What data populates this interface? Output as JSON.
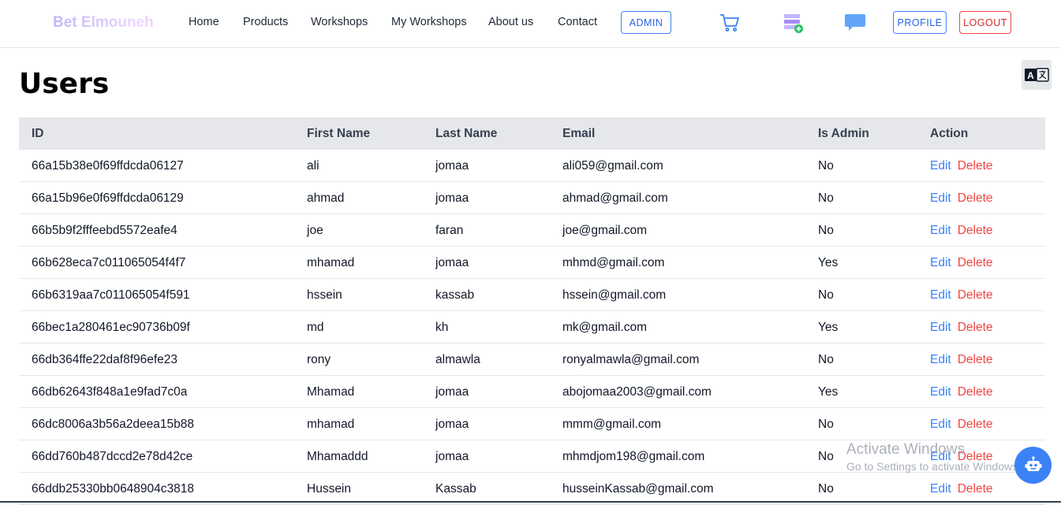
{
  "nav": {
    "brand": "Bet Elmouneh",
    "links": [
      "Home",
      "Products",
      "Workshops",
      "My Workshops",
      "About us",
      "Contact"
    ],
    "admin_label": "ADMIN",
    "profile_label": "PROFILE",
    "logout_label": "LOGOUT",
    "icons": [
      "cart-icon",
      "add-list-icon",
      "chat-icon"
    ]
  },
  "translate_icon": "translate-icon",
  "page": {
    "title": "Users"
  },
  "table": {
    "headers": [
      "ID",
      "First Name",
      "Last Name",
      "Email",
      "Is Admin",
      "Action"
    ],
    "edit_label": "Edit",
    "delete_label": "Delete",
    "rows": [
      {
        "id": "66a15b38e0f69ffdcda06127",
        "first": "ali",
        "last": "jomaa",
        "email": "ali059@gmail.com",
        "admin": "No"
      },
      {
        "id": "66a15b96e0f69ffdcda06129",
        "first": "ahmad",
        "last": "jomaa",
        "email": "ahmad@gmail.com",
        "admin": "No"
      },
      {
        "id": "66b5b9f2fffeebd5572eafe4",
        "first": "joe",
        "last": "faran",
        "email": "joe@gmail.com",
        "admin": "No"
      },
      {
        "id": "66b628eca7c011065054f4f7",
        "first": "mhamad",
        "last": "jomaa",
        "email": "mhmd@gmail.com",
        "admin": "Yes"
      },
      {
        "id": "66b6319aa7c011065054f591",
        "first": "hssein",
        "last": "kassab",
        "email": "hssein@gmail.com",
        "admin": "No"
      },
      {
        "id": "66bec1a280461ec90736b09f",
        "first": "md",
        "last": "kh",
        "email": "mk@gmail.com",
        "admin": "Yes"
      },
      {
        "id": "66db364ffe22daf8f96efe23",
        "first": "rony",
        "last": "almawla",
        "email": "ronyalmawla@gmail.com",
        "admin": "No"
      },
      {
        "id": "66db62643f848a1e9fad7c0a",
        "first": "Mhamad",
        "last": "jomaa",
        "email": "abojomaa2003@gmail.com",
        "admin": "Yes"
      },
      {
        "id": "66dc8006a3b56a2deea15b88",
        "first": "mhamad",
        "last": "jomaa",
        "email": "mmm@gmail.com",
        "admin": "No"
      },
      {
        "id": "66dd760b487dccd2e78d42ce",
        "first": "Mhamaddd",
        "last": "jomaa",
        "email": "mhmdjom198@gmail.com",
        "admin": "No"
      },
      {
        "id": "66ddb25330bb0648904c3818",
        "first": "Hussein",
        "last": "Kassab",
        "email": "husseinKassab@gmail.com",
        "admin": "No"
      }
    ]
  },
  "watermark": {
    "title": "Activate Windows",
    "subtitle": "Go to Settings to activate Windows."
  },
  "chatbot_icon": "robot-icon",
  "colors": {
    "accent": "#3b82f6",
    "danger": "#ef4444",
    "header_bg": "#e5e7eb"
  }
}
